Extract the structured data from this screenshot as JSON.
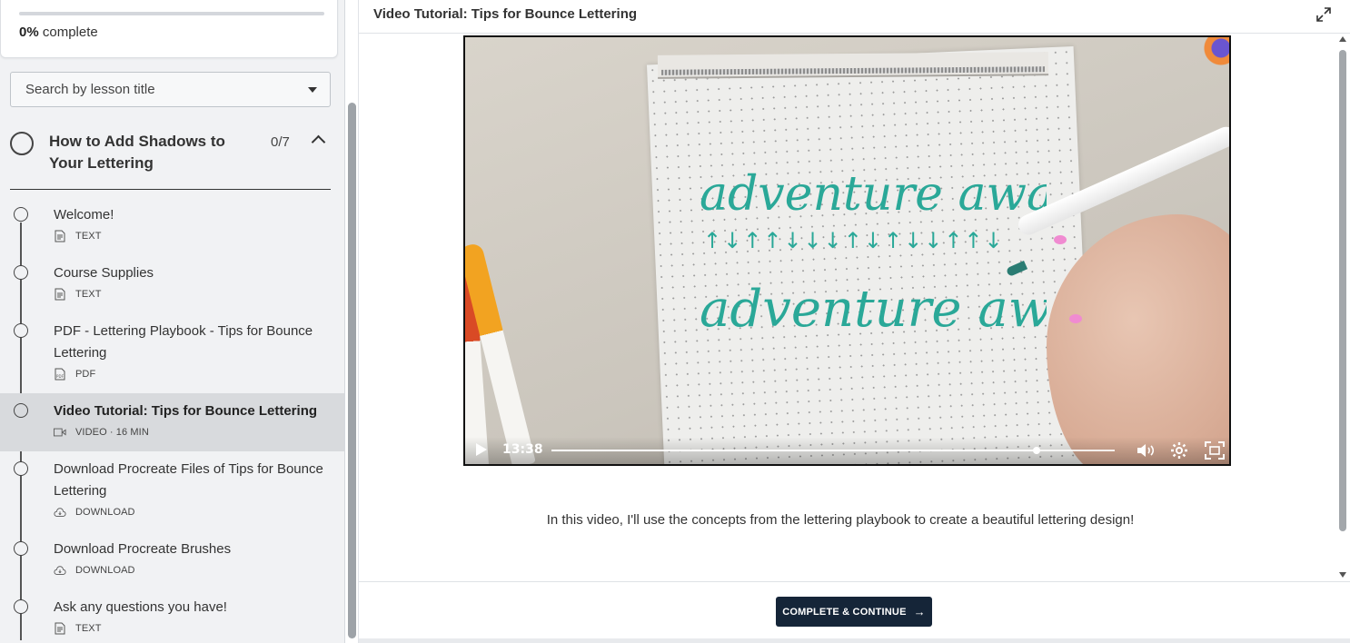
{
  "progress": {
    "percent": 0,
    "percent_label": "0%",
    "suffix": "complete"
  },
  "search": {
    "placeholder": "Search by lesson title"
  },
  "chapter": {
    "title": "How to Add Shadows to Your Lettering",
    "count": "0/7"
  },
  "lessons": [
    {
      "title": "Welcome!",
      "type": "TEXT",
      "icon": "text-doc-icon"
    },
    {
      "title": "Course Supplies",
      "type": "TEXT",
      "icon": "text-doc-icon"
    },
    {
      "title": "PDF - Lettering Playbook - Tips for Bounce Lettering",
      "type": "PDF",
      "icon": "pdf-icon"
    },
    {
      "title": "Video Tutorial: Tips for Bounce Lettering",
      "type": "VIDEO · 16 MIN",
      "icon": "video-icon"
    },
    {
      "title": "Download Procreate Files of Tips for Bounce Lettering",
      "type": "DOWNLOAD",
      "icon": "cloud-download-icon"
    },
    {
      "title": "Download Procreate Brushes",
      "type": "DOWNLOAD",
      "icon": "cloud-download-icon"
    },
    {
      "title": "Ask any questions you have!",
      "type": "TEXT",
      "icon": "text-doc-icon"
    }
  ],
  "main": {
    "title": "Video Tutorial: Tips for Bounce Lettering",
    "description": "In this video, I'll use the concepts from the lettering playbook to create a beautiful lettering design!",
    "complete_label": "COMPLETE & CONTINUE"
  },
  "video": {
    "time": "13:38",
    "progress_fraction": 0.862,
    "art_text_1": "adventure awaits",
    "art_text_2": "adventure awaits",
    "art_arrows": "↑↓↑↑↓↓↓↑↓↑↓↓↑↑↓",
    "lettering_color": "#2aa898"
  },
  "colors": {
    "primary": "#152538",
    "sidebar_bg": "#f1f2f4",
    "active_row": "#d8dadd"
  }
}
